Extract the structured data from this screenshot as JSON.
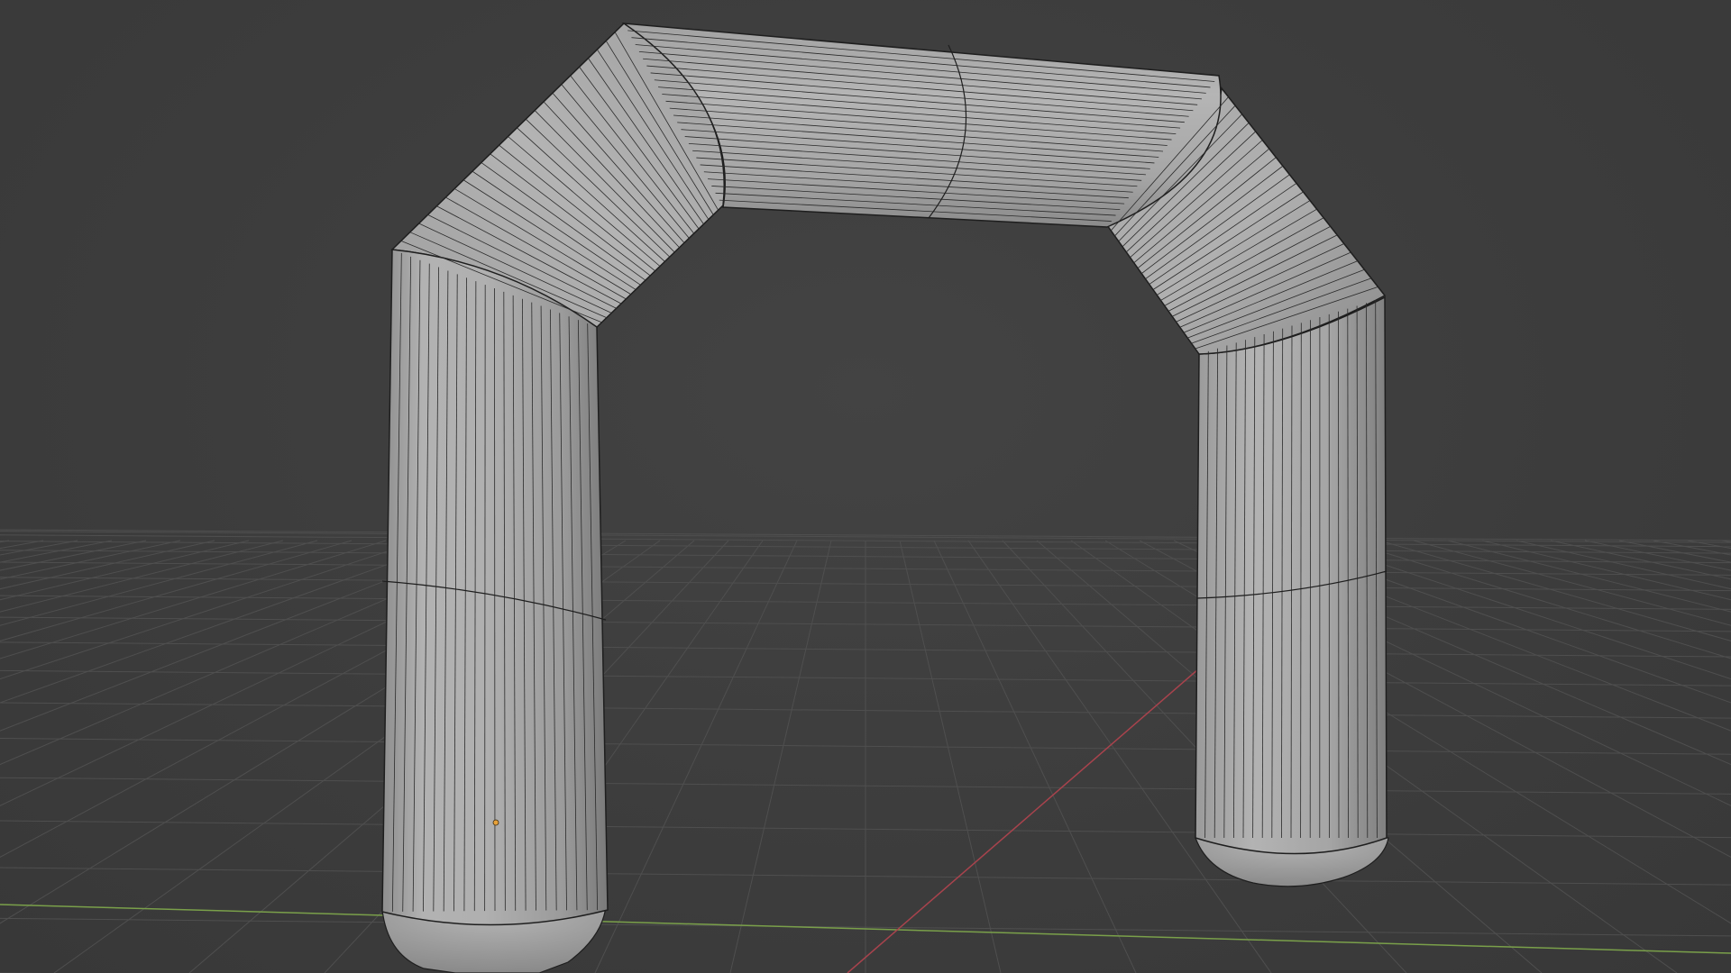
{
  "viewport": {
    "mode": "Edit Mode",
    "shading": "solid",
    "overlay": "wireframe",
    "background_color": "#3d3d3d",
    "grid_color": "#4f4f4f",
    "x_axis_color": "#a8434d",
    "y_axis_color": "#7aa04a",
    "mesh_color": "#a9a9a9",
    "edge_color": "#1e1e1e",
    "origin_color": "#e8a23a"
  },
  "scene": {
    "object": {
      "shape": "inflatable arch",
      "parts": [
        "left-leg",
        "left-elbow",
        "top-beam",
        "right-elbow",
        "right-leg",
        "left-foot-cap",
        "right-foot-cap"
      ]
    },
    "origin_icon": "object-origin-dot"
  }
}
